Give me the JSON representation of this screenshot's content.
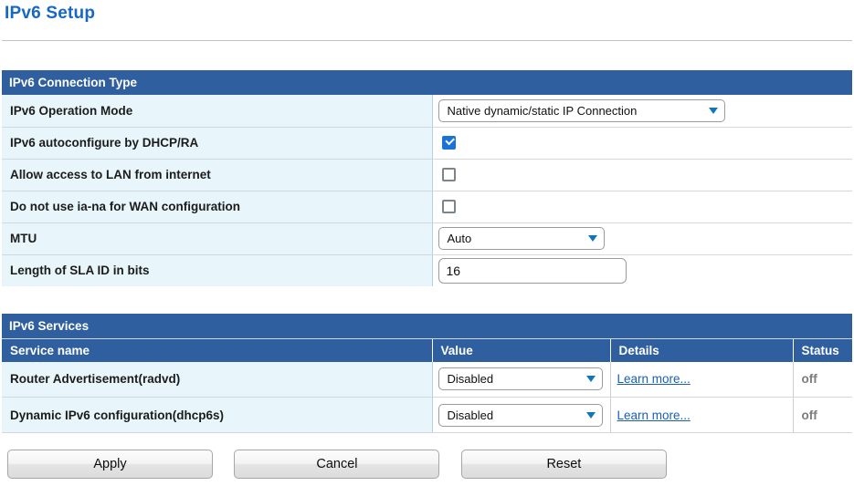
{
  "page": {
    "title": "IPv6 Setup"
  },
  "connection_type": {
    "section_title": "IPv6 Connection Type",
    "rows": [
      {
        "label": "IPv6 Operation Mode",
        "control": "select",
        "value": "Native dynamic/static IP Connection"
      },
      {
        "label": "IPv6 autoconfigure by DHCP/RA",
        "control": "checkbox",
        "checked": "true"
      },
      {
        "label": "Allow access to LAN from internet",
        "control": "checkbox",
        "checked": "false"
      },
      {
        "label": "Do not use ia-na for WAN configuration",
        "control": "checkbox",
        "checked": "false"
      },
      {
        "label": "MTU",
        "control": "select",
        "value": "Auto"
      },
      {
        "label": "Length of SLA ID in bits",
        "control": "text",
        "value": "16",
        "placeholder": ""
      }
    ]
  },
  "services": {
    "section_title": "IPv6 Services",
    "columns": {
      "name": "Service name",
      "value": "Value",
      "details": "Details",
      "status": "Status"
    },
    "rows": [
      {
        "name": "Router Advertisement(radvd)",
        "value": "Disabled",
        "details_link": "Learn more...",
        "status": "off"
      },
      {
        "name": "Dynamic IPv6 configuration(dhcp6s)",
        "value": "Disabled",
        "details_link": "Learn more...",
        "status": "off"
      }
    ]
  },
  "buttons": {
    "apply": "Apply",
    "cancel": "Cancel",
    "reset": "Reset"
  },
  "colors": {
    "section_header_bg": "#2f5f9e",
    "title_blue": "#1668c4",
    "label_cell_bg": "#e8f6fc",
    "link_blue": "#1a5fb4",
    "checkbox_on": "#1a73d8",
    "caret_blue": "#1076b8",
    "status_gray": "#7c7c7c"
  }
}
